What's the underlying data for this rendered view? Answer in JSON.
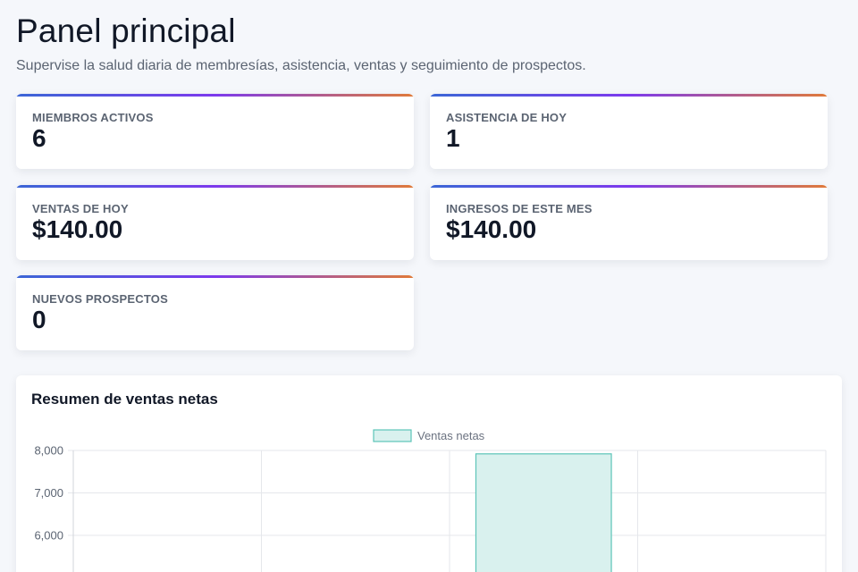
{
  "header": {
    "title": "Panel principal",
    "subtitle": "Supervise la salud diaria de membresías, asistencia, ventas y seguimiento de prospectos."
  },
  "stats": [
    {
      "label": "MIEMBROS ACTIVOS",
      "value": "6"
    },
    {
      "label": "ASISTENCIA DE HOY",
      "value": "1"
    },
    {
      "label": "VENTAS DE HOY",
      "value": "$140.00"
    },
    {
      "label": "INGRESOS DE ESTE MES",
      "value": "$140.00"
    },
    {
      "label": "NUEVOS PROSPECTOS",
      "value": "0"
    }
  ],
  "colors": {
    "accent_start": "#3b66d6",
    "accent_mid": "#7c3aed",
    "accent_end": "#e07a3a",
    "bar_fill": "#d9f1ee",
    "bar_stroke": "#5cc4b8"
  },
  "chart": {
    "title": "Resumen de ventas netas"
  },
  "chart_data": {
    "type": "bar",
    "categories": [
      "",
      "",
      "",
      ""
    ],
    "series": [
      {
        "name": "Ventas netas",
        "values": [
          0,
          0,
          7920,
          0
        ]
      }
    ],
    "ylim_visible": [
      5000,
      8000
    ],
    "ytick_labels": [
      "8,000",
      "7,000",
      "6,000"
    ],
    "yticks": [
      8000,
      7000,
      6000
    ],
    "grid": true,
    "legend": "top-center"
  }
}
